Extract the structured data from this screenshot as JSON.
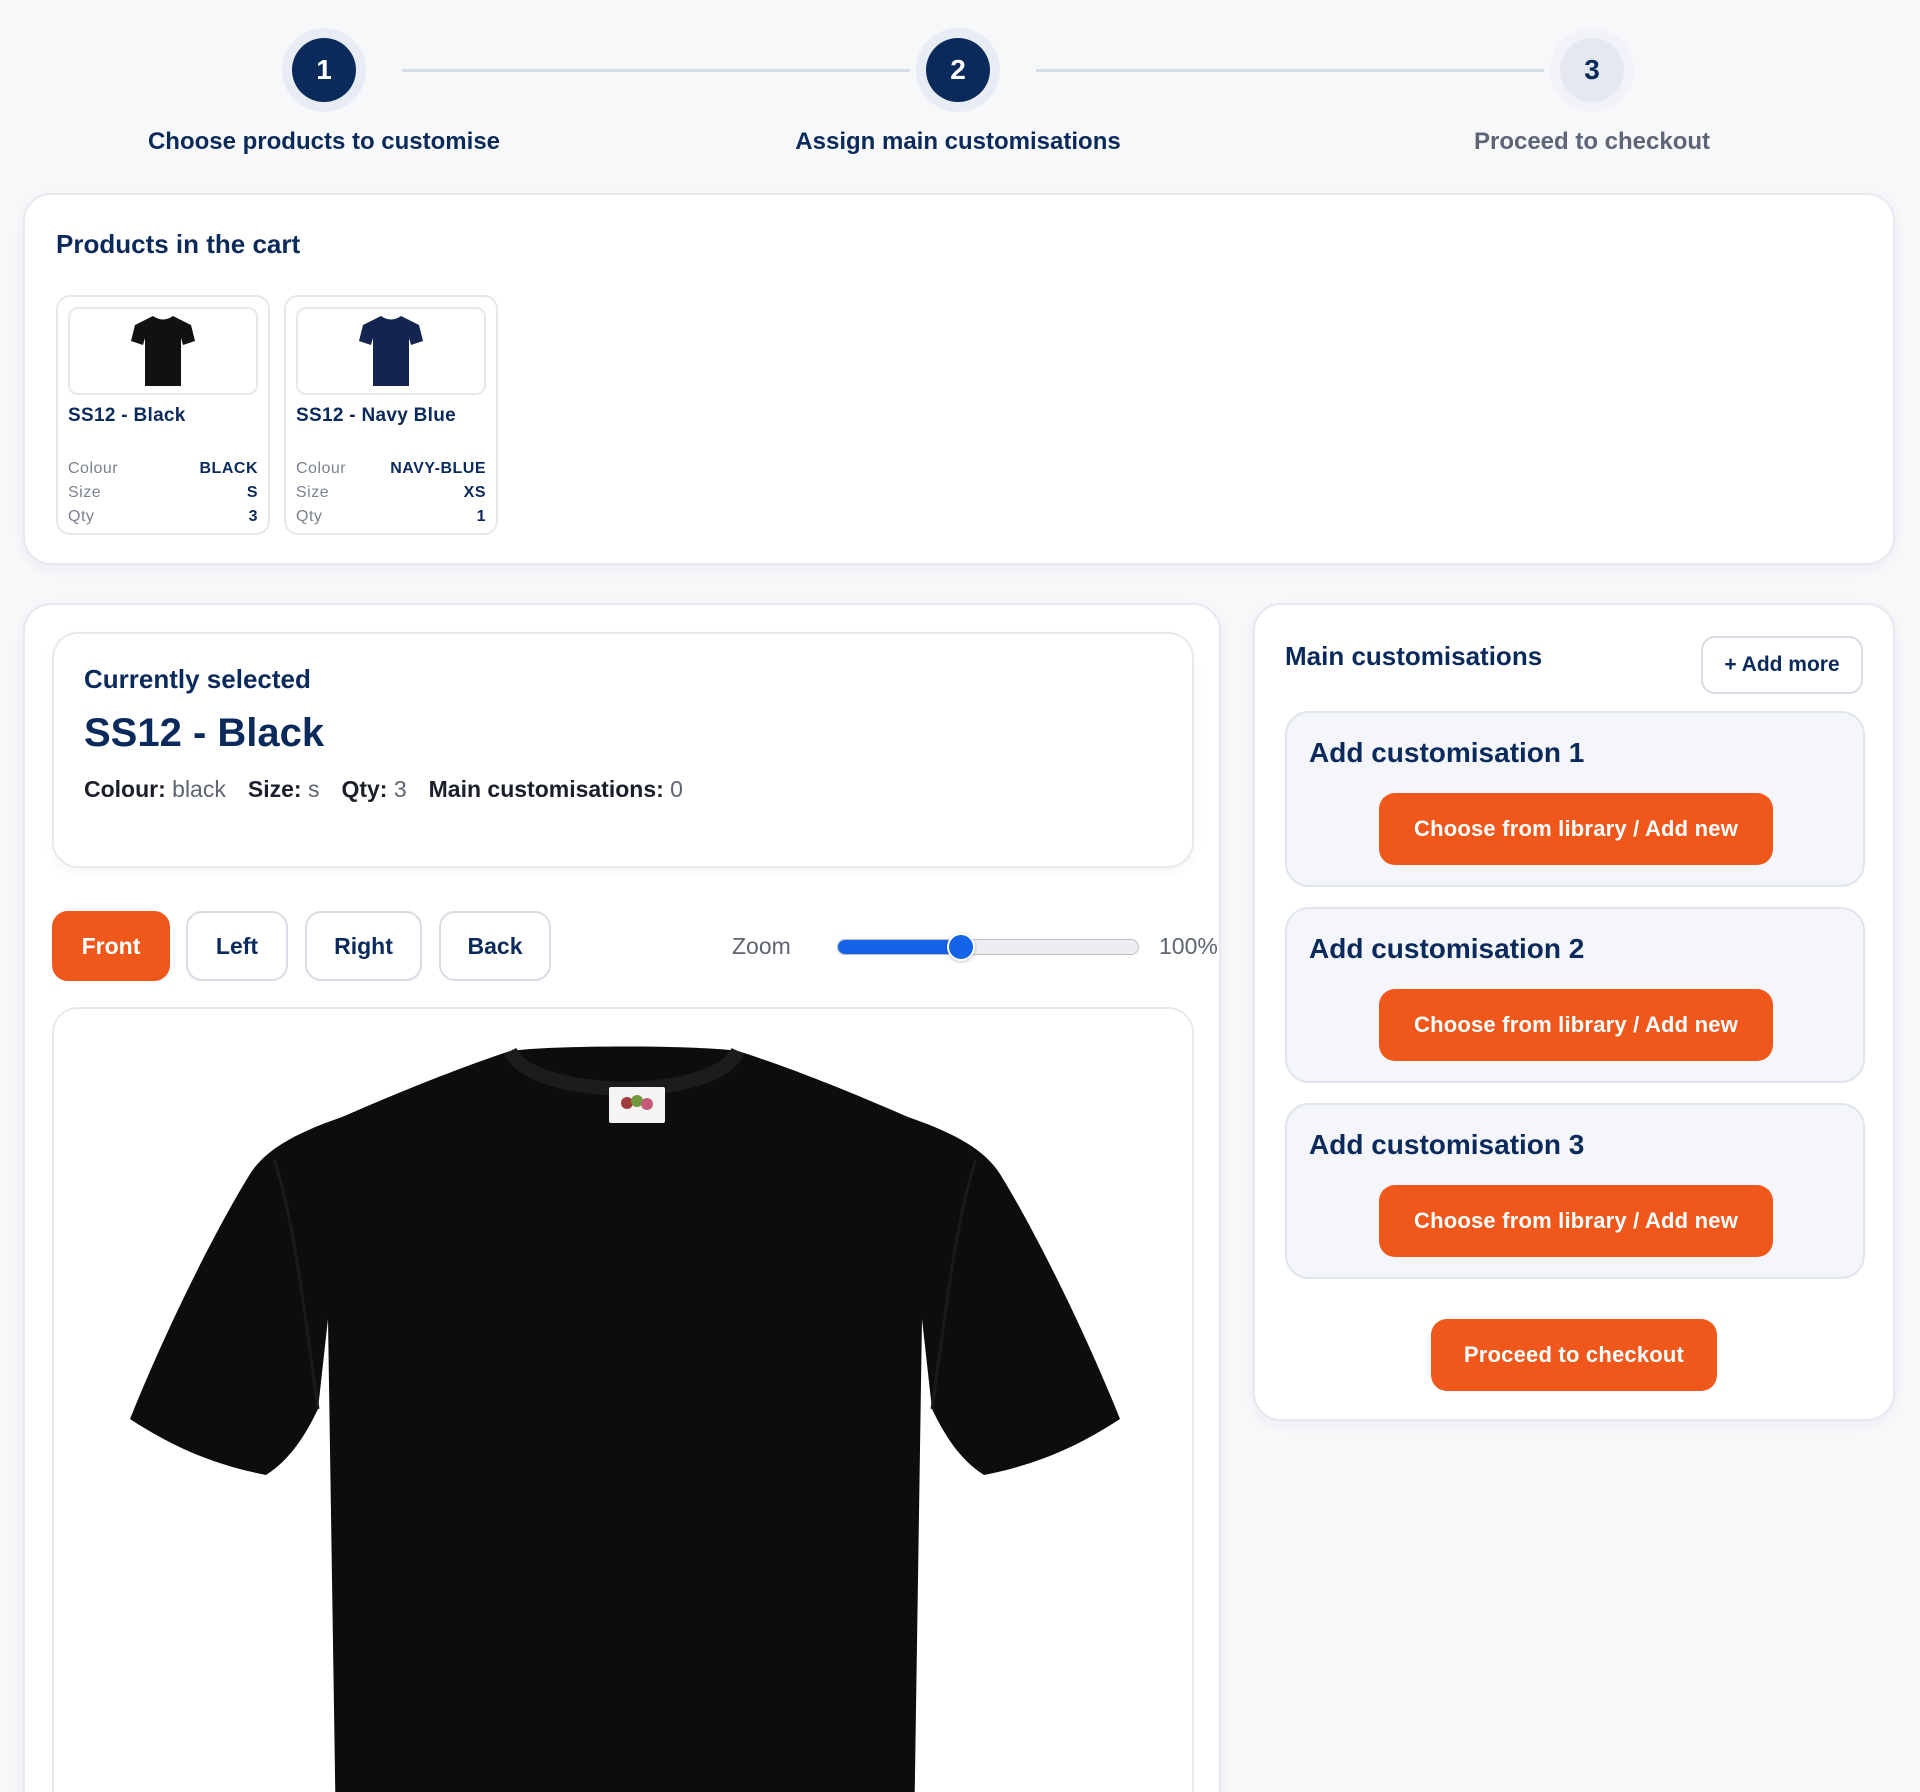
{
  "stepper": {
    "steps": [
      {
        "number": "1",
        "label": "Choose products to customise",
        "state": "active"
      },
      {
        "number": "2",
        "label": "Assign main customisations",
        "state": "active"
      },
      {
        "number": "3",
        "label": "Proceed to checkout",
        "state": "pending"
      }
    ]
  },
  "cart": {
    "title": "Products in the cart",
    "products": [
      {
        "name": "SS12 - Black",
        "colour_label": "Colour",
        "colour": "BLACK",
        "size_label": "Size",
        "size": "S",
        "qty_label": "Qty",
        "qty": "3",
        "shirt_color": "#111111"
      },
      {
        "name": "SS12 - Navy Blue",
        "colour_label": "Colour",
        "colour": "NAVY-BLUE",
        "size_label": "Size",
        "size": "XS",
        "qty_label": "Qty",
        "qty": "1",
        "shirt_color": "#13254f"
      }
    ]
  },
  "selected": {
    "heading": "Currently selected",
    "title": "SS12 - Black",
    "colour_label": "Colour:",
    "colour": "black",
    "size_label": "Size:",
    "size": "s",
    "qty_label": "Qty:",
    "qty": "3",
    "main_custom_label": "Main customisations:",
    "main_custom_count": "0"
  },
  "views": {
    "buttons": [
      "Front",
      "Left",
      "Right",
      "Back"
    ],
    "active": "Front",
    "zoom_label": "Zoom",
    "zoom_value": "100%",
    "zoom_slider_fraction": 0.41
  },
  "preview": {
    "shirt_color": "#0d0d0d"
  },
  "customisations": {
    "title": "Main customisations",
    "add_more_label": "+ Add more",
    "items": [
      {
        "title": "Add customisation 1",
        "button": "Choose from library / Add new"
      },
      {
        "title": "Add customisation 2",
        "button": "Choose from library / Add new"
      },
      {
        "title": "Add customisation 3",
        "button": "Choose from library / Add new"
      }
    ],
    "checkout_label": "Proceed to checkout"
  },
  "colors": {
    "brand_navy": "#0b2a5c",
    "accent_orange": "#f0571a",
    "slider_blue": "#1463e8"
  }
}
